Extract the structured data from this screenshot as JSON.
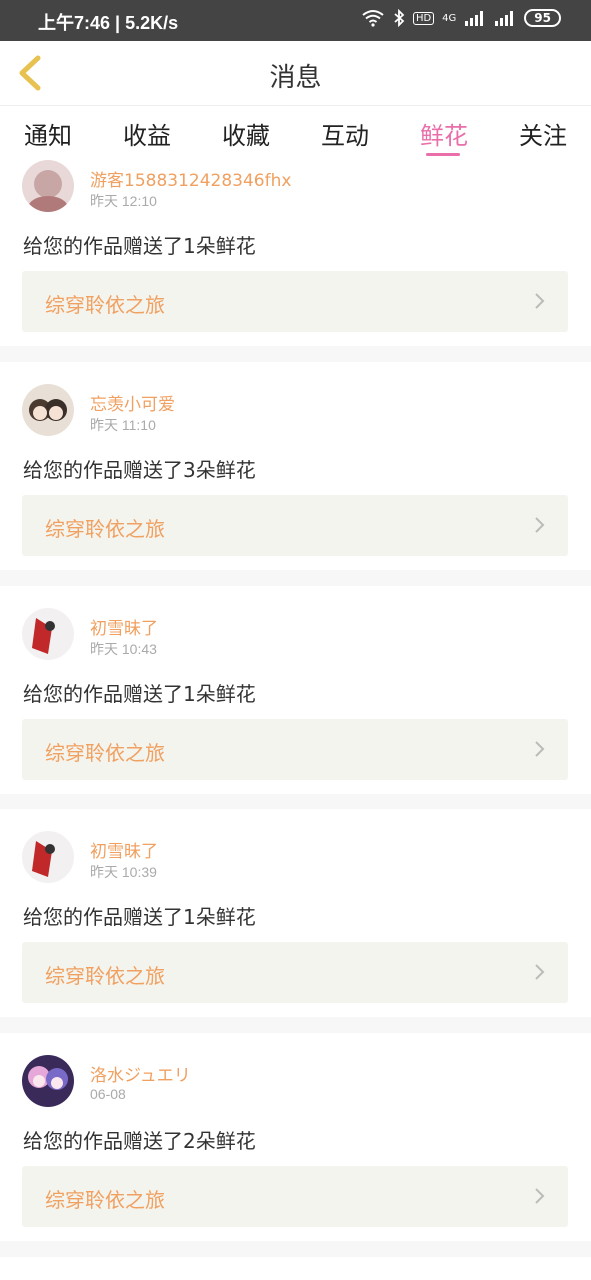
{
  "status_bar": {
    "time_speed": "上午7:46 | 5.2K/s",
    "network_label": "4G",
    "hd_label": "HD",
    "battery": "95"
  },
  "header": {
    "title": "消息"
  },
  "tabs": [
    {
      "label": "通知",
      "active": false
    },
    {
      "label": "收益",
      "active": false
    },
    {
      "label": "收藏",
      "active": false
    },
    {
      "label": "互动",
      "active": false
    },
    {
      "label": "鲜花",
      "active": true
    },
    {
      "label": "关注",
      "active": false
    }
  ],
  "messages": [
    {
      "user": "游客1588312428346fhx",
      "time": "昨天 12:10",
      "text": "给您的作品赠送了1朵鲜花",
      "work": "综穿聆依之旅"
    },
    {
      "user": "忘羡小可爱",
      "time": "昨天 11:10",
      "text": "给您的作品赠送了3朵鲜花",
      "work": "综穿聆依之旅"
    },
    {
      "user": "初雪昧了",
      "time": "昨天 10:43",
      "text": "给您的作品赠送了1朵鲜花",
      "work": "综穿聆依之旅"
    },
    {
      "user": "初雪昧了",
      "time": "昨天 10:39",
      "text": "给您的作品赠送了1朵鲜花",
      "work": "综穿聆依之旅"
    },
    {
      "user": "洛水ジュエリ",
      "time": "06-08",
      "text": "给您的作品赠送了2朵鲜花",
      "work": "综穿聆依之旅"
    }
  ],
  "colors": {
    "accent": "#e96eaa",
    "user_name": "#f0a060",
    "status_bar": "#444444"
  }
}
